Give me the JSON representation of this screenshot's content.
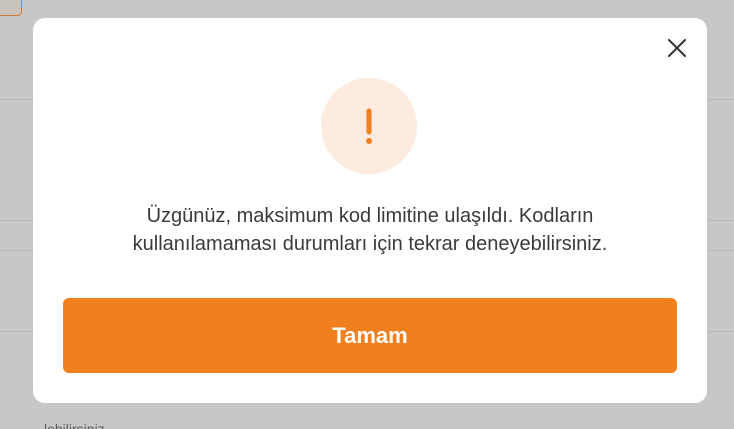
{
  "dialog": {
    "message": "Üzgünüz, maksimum kod limitine ulaşıldı. Kodların kullanılamaması durumları için tekrar deneyebilirsiniz.",
    "confirm_label": "Tamam",
    "icon": "exclamation-icon",
    "close_icon": "close-icon"
  },
  "background": {
    "partial_text": "…lebilirsiniz…"
  },
  "colors": {
    "accent": "#f07f1e",
    "icon_bg": "#fdebe0",
    "overlay": "#c7c7c7"
  }
}
